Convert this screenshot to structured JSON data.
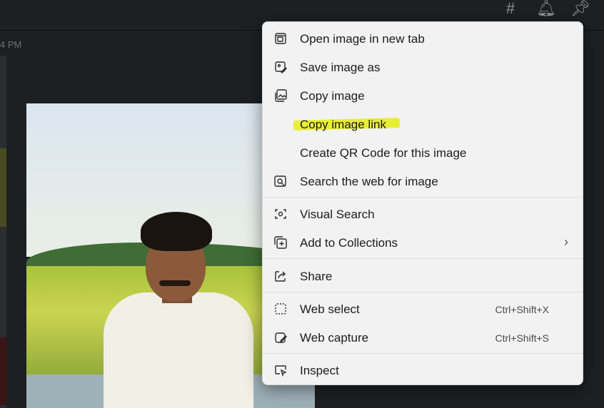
{
  "header": {
    "icons": [
      "hashtag-icon",
      "bell-icon",
      "pin-icon"
    ]
  },
  "chat": {
    "timestamp": "4 PM"
  },
  "context_menu": {
    "items": [
      {
        "label": "Open image in new tab",
        "icon": "open-new-tab-icon"
      },
      {
        "label": "Save image as",
        "icon": "save-image-icon"
      },
      {
        "label": "Copy image",
        "icon": "copy-image-icon"
      },
      {
        "label": "Copy image link",
        "icon": "",
        "highlighted": true,
        "highlight_color": "#e7ed2a"
      },
      {
        "label": "Create QR Code for this image",
        "icon": ""
      },
      {
        "label": "Search the web for image",
        "icon": "search-web-image-icon"
      },
      {
        "label": "Visual Search",
        "icon": "visual-search-icon"
      },
      {
        "label": "Add to Collections",
        "icon": "collections-icon",
        "submenu": true
      },
      {
        "label": "Share",
        "icon": "share-icon"
      },
      {
        "label": "Web select",
        "icon": "web-select-icon",
        "shortcut": "Ctrl+Shift+X"
      },
      {
        "label": "Web capture",
        "icon": "web-capture-icon",
        "shortcut": "Ctrl+Shift+S"
      },
      {
        "label": "Inspect",
        "icon": "inspect-icon"
      }
    ]
  }
}
